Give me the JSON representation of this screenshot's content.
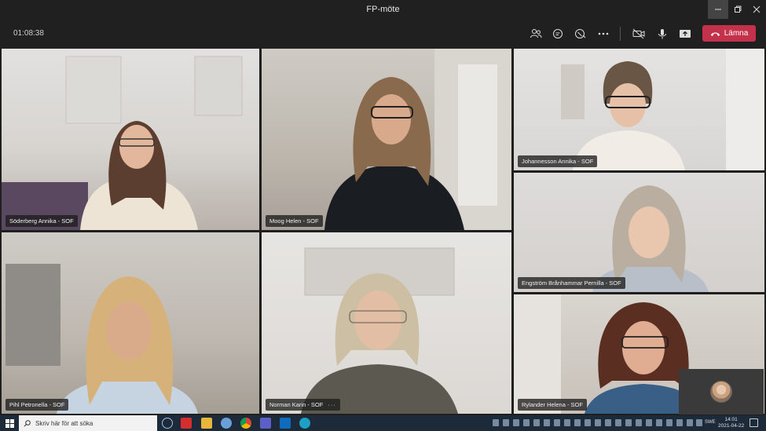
{
  "window": {
    "title": "FP-möte"
  },
  "call": {
    "timer": "01:08:38",
    "leave_label": "Lämna",
    "icons": [
      "participants-icon",
      "chat-icon",
      "reactions-icon",
      "more-icon",
      "camera-off-icon",
      "microphone-icon",
      "share-icon",
      "phone-hangup-icon"
    ]
  },
  "participants": [
    {
      "name": "Söderberg Annika - SOF"
    },
    {
      "name": "Moog Helen - SOF"
    },
    {
      "name": "Johannesson Annika - SOF"
    },
    {
      "name": "Engström Brånhammar Pernilla - SOF"
    },
    {
      "name": "Pihl Petronella - SOF"
    },
    {
      "name": "Norman Karin - SOF",
      "more": "···"
    },
    {
      "name": "Rylander Helena - SOF"
    }
  ],
  "taskbar": {
    "search_placeholder": "Skriv här för att söka",
    "language": "SWE",
    "time": "14:01",
    "date": "2021-04-22"
  },
  "colors": {
    "leave": "#c4314b",
    "titlebar": "#202020",
    "taskbar": "#1c2a3a"
  }
}
